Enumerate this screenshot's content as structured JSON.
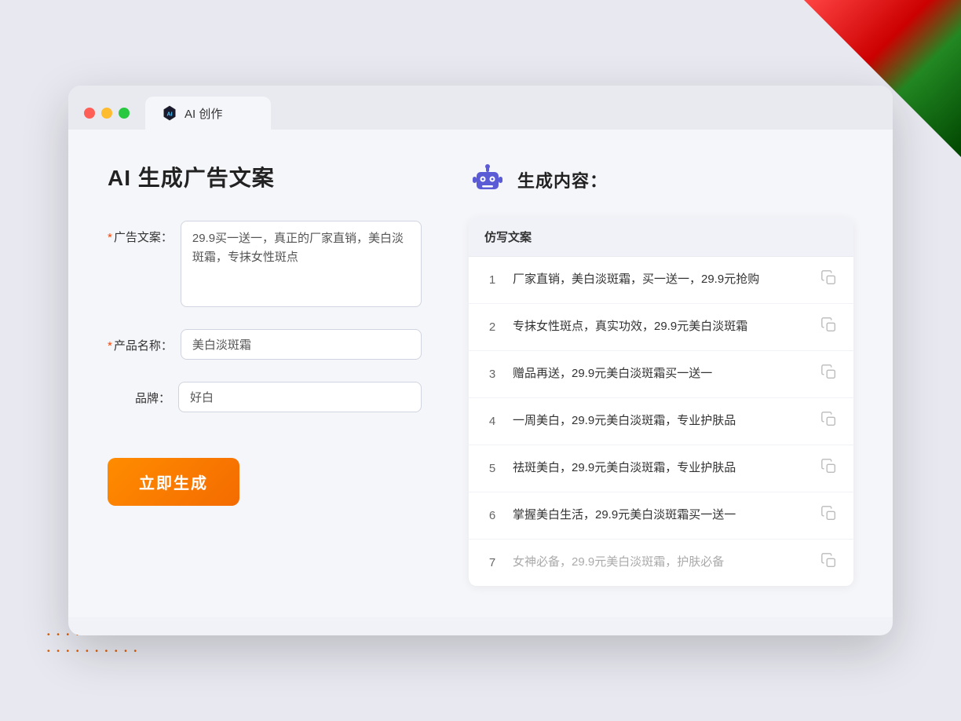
{
  "window": {
    "tab_label": "AI 创作"
  },
  "page": {
    "title": "AI 生成广告文案"
  },
  "form": {
    "ad_copy_label": "广告文案：",
    "ad_copy_required": "*",
    "ad_copy_value": "29.9买一送一，真正的厂家直销，美白淡斑霜，专抹女性斑点",
    "product_name_label": "产品名称：",
    "product_name_required": "*",
    "product_name_value": "美白淡斑霜",
    "brand_label": "品牌：",
    "brand_value": "好白",
    "generate_button_label": "立即生成"
  },
  "result": {
    "title": "生成内容：",
    "table_header": "仿写文案",
    "items": [
      {
        "num": "1",
        "text": "厂家直销，美白淡斑霜，买一送一，29.9元抢购",
        "muted": false
      },
      {
        "num": "2",
        "text": "专抹女性斑点，真实功效，29.9元美白淡斑霜",
        "muted": false
      },
      {
        "num": "3",
        "text": "赠品再送，29.9元美白淡斑霜买一送一",
        "muted": false
      },
      {
        "num": "4",
        "text": "一周美白，29.9元美白淡斑霜，专业护肤品",
        "muted": false
      },
      {
        "num": "5",
        "text": "祛斑美白，29.9元美白淡斑霜，专业护肤品",
        "muted": false
      },
      {
        "num": "6",
        "text": "掌握美白生活，29.9元美白淡斑霜买一送一",
        "muted": false
      },
      {
        "num": "7",
        "text": "女神必备，29.9元美白淡斑霜，护肤必备",
        "muted": true
      }
    ]
  },
  "colors": {
    "accent_orange": "#f46b00",
    "required_red": "#ff4400",
    "border": "#d0d4e0"
  }
}
